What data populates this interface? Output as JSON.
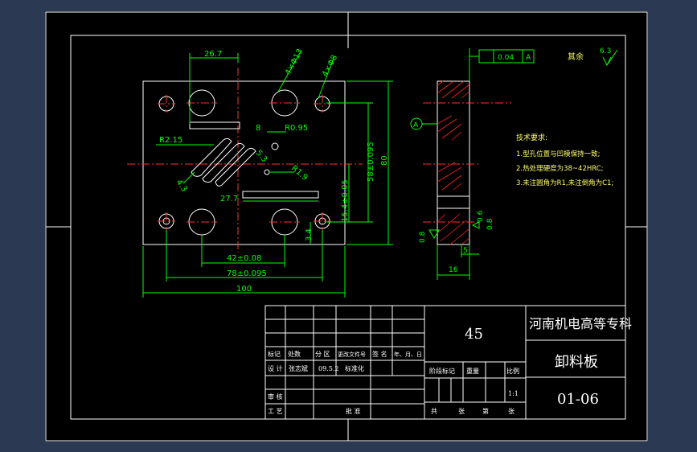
{
  "drawing": {
    "material": "45",
    "school": "河南机电高等专科",
    "part_name": "卸料板",
    "part_number": "01-06",
    "scale": "1:1"
  },
  "title_block": {
    "row1": [
      "标记",
      "处数",
      "分 区",
      "更改文件号",
      "签 名",
      "年、月、日"
    ],
    "design_label": "设 计",
    "designer": "张志斌",
    "date": "09.5.2",
    "std_label": "标准化",
    "stage_headers": [
      "阶段标记",
      "重量",
      "比例"
    ],
    "review_label": "审 核",
    "process_label": "工 艺",
    "approve_label": "批 准",
    "sheet_row": [
      "共",
      "张",
      "第",
      "张"
    ]
  },
  "dimensions": {
    "d1": "26.7",
    "d2": "4×Φ13",
    "d3": "4×Φ8",
    "d4": "R2.15",
    "d5": "R0.95",
    "d6": "8",
    "d7": "5.3",
    "d8": "R1.9",
    "d9": "4.3",
    "d10": "27.7",
    "d11": "58±0.095",
    "d12": "80",
    "d13": "15.4±0.05",
    "d14": "3.4",
    "d15": "42±0.08",
    "d16": "78±0.095",
    "d17": "100",
    "s1": "0.04",
    "s2": "A",
    "s3": "A",
    "s4": "0.8",
    "s5": "0.6",
    "s6": "0.8",
    "s7": "5",
    "s8": "16",
    "rest": "其余",
    "rough": "6.3"
  },
  "notes": {
    "title": "技术要求:",
    "items": [
      "1.型孔位置与凹模保持一致;",
      "2.热处理硬度为38~42HRC;",
      "3.未注圆角为R1,未注倒角为C1;"
    ]
  }
}
